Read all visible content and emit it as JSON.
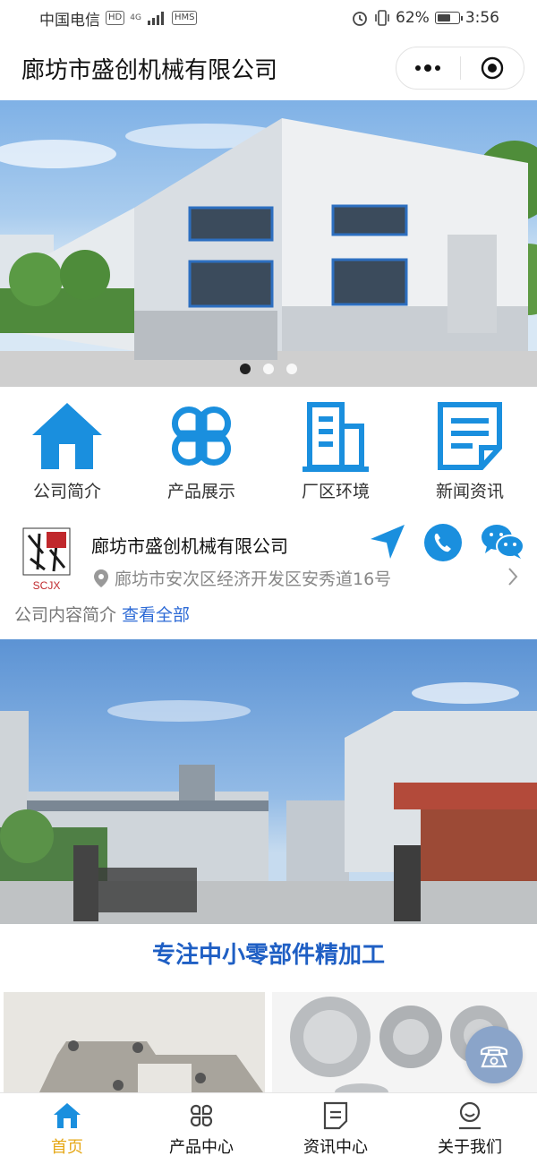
{
  "status_bar": {
    "carrier": "中国电信",
    "hd": "HD",
    "network": "4G",
    "sms": "HMS",
    "battery": "62%",
    "time": "3:56"
  },
  "header": {
    "title": "廊坊市盛创机械有限公司"
  },
  "banner": {
    "slides": 3,
    "active_slide": 1
  },
  "menu": [
    {
      "label": "公司简介",
      "icon": "home-icon"
    },
    {
      "label": "产品展示",
      "icon": "grid-icon"
    },
    {
      "label": "厂区环境",
      "icon": "building-icon"
    },
    {
      "label": "新闻资讯",
      "icon": "document-icon"
    }
  ],
  "company": {
    "name": "廊坊市盛创机械有限公司",
    "address": "廊坊市安次区经济开发区安秀道16号",
    "logo_text": "SCJX",
    "intro_label": "公司内容简介",
    "intro_link": "查看全部"
  },
  "headline": "专注中小零部件精加工",
  "tabbar": [
    {
      "label": "首页",
      "icon": "home-icon",
      "active": true
    },
    {
      "label": "产品中心",
      "icon": "grid-icon",
      "active": false
    },
    {
      "label": "资讯中心",
      "icon": "document-icon",
      "active": false
    },
    {
      "label": "关于我们",
      "icon": "user-icon",
      "active": false
    }
  ],
  "colors": {
    "accent": "#1a8fde",
    "headline": "#1f5fc4",
    "active_tab": "#e6a817",
    "link": "#2e6bd6"
  }
}
